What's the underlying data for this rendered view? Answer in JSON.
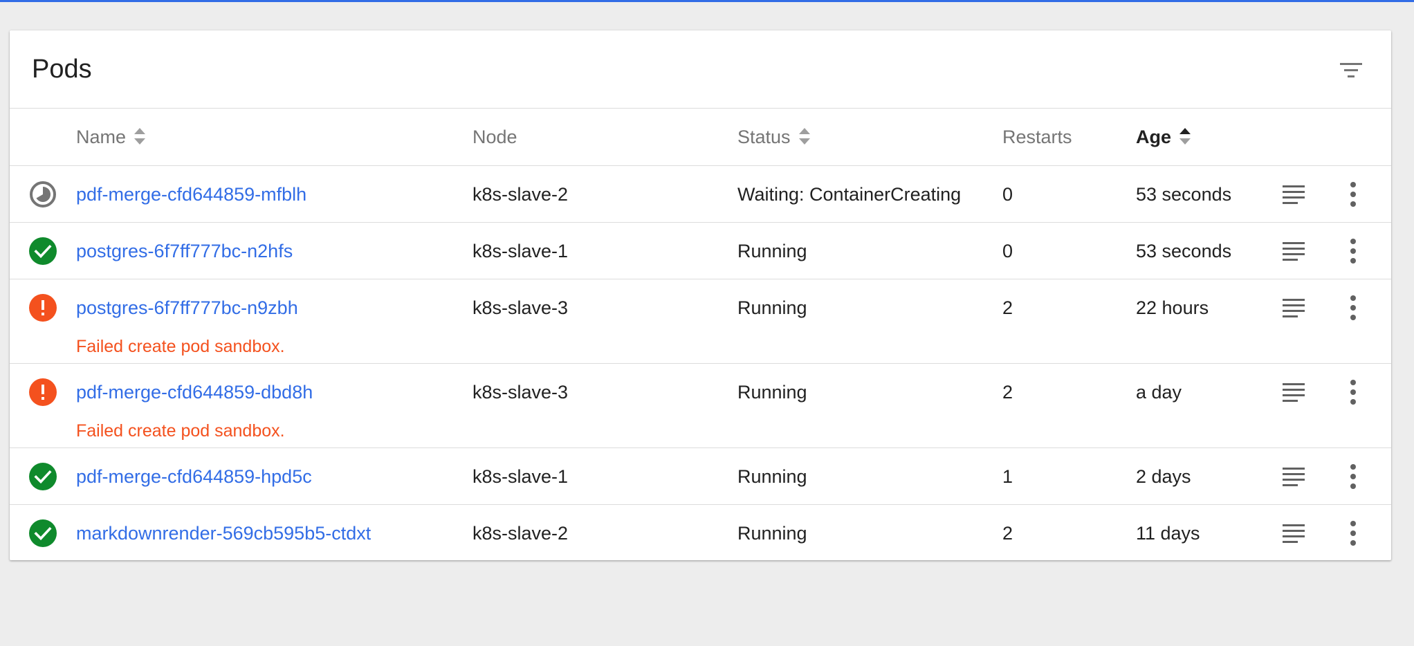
{
  "card": {
    "title": "Pods"
  },
  "columns": {
    "name": "Name",
    "node": "Node",
    "status": "Status",
    "restarts": "Restarts",
    "age": "Age"
  },
  "icons": {
    "filter": "filter-icon",
    "sort": "sort-icon",
    "pending": "pending-icon",
    "success": "check-circle-icon",
    "error": "error-icon",
    "logs": "logs-icon",
    "more": "more-vert-icon"
  },
  "colors": {
    "accent": "#326de6",
    "success": "#0f8a2c",
    "error": "#f4511e",
    "pending": "#757575"
  },
  "pods": [
    {
      "state": "pending",
      "name": "pdf-merge-cfd644859-mfblh",
      "node": "k8s-slave-2",
      "status": "Waiting: ContainerCreating",
      "restarts": "0",
      "age": "53 seconds",
      "error": ""
    },
    {
      "state": "success",
      "name": "postgres-6f7ff777bc-n2hfs",
      "node": "k8s-slave-1",
      "status": "Running",
      "restarts": "0",
      "age": "53 seconds",
      "error": ""
    },
    {
      "state": "error",
      "name": "postgres-6f7ff777bc-n9zbh",
      "node": "k8s-slave-3",
      "status": "Running",
      "restarts": "2",
      "age": "22 hours",
      "error": "Failed create pod sandbox."
    },
    {
      "state": "error",
      "name": "pdf-merge-cfd644859-dbd8h",
      "node": "k8s-slave-3",
      "status": "Running",
      "restarts": "2",
      "age": "a day",
      "error": "Failed create pod sandbox."
    },
    {
      "state": "success",
      "name": "pdf-merge-cfd644859-hpd5c",
      "node": "k8s-slave-1",
      "status": "Running",
      "restarts": "1",
      "age": "2 days",
      "error": ""
    },
    {
      "state": "success",
      "name": "markdownrender-569cb595b5-ctdxt",
      "node": "k8s-slave-2",
      "status": "Running",
      "restarts": "2",
      "age": "11 days",
      "error": ""
    }
  ]
}
